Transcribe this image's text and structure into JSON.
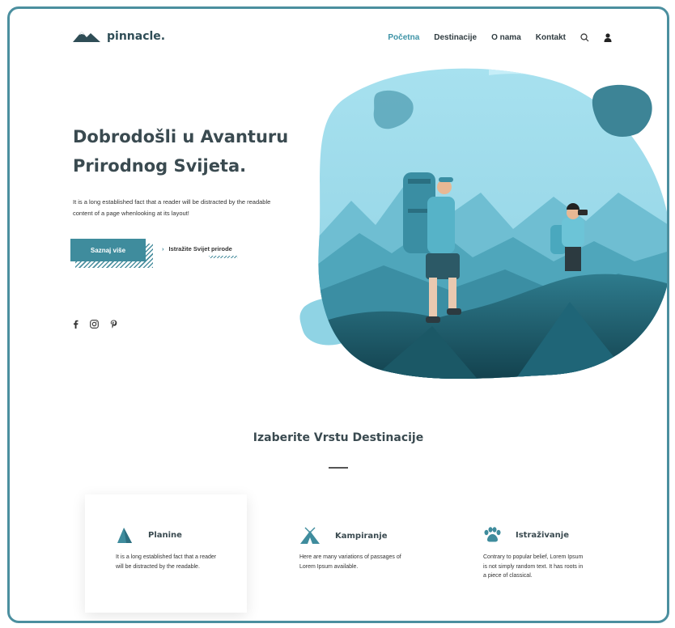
{
  "brand": {
    "name": "pinnacle."
  },
  "nav": {
    "items": [
      {
        "label": "Početna",
        "active": true
      },
      {
        "label": "Destinacije",
        "active": false
      },
      {
        "label": "O nama",
        "active": false
      },
      {
        "label": "Kontakt",
        "active": false
      }
    ],
    "icons": [
      "search-icon",
      "user-icon"
    ]
  },
  "hero": {
    "title": "Dobrodošli u Avanturu Prirodnog Svijeta.",
    "text": "It is a long established fact that a reader will be distracted by the readable content of a page whenlooking at its layout!",
    "primary_button": "Saznaj više",
    "secondary_link": "Istražite Svijet prirode",
    "social_icons": [
      "facebook-icon",
      "instagram-icon",
      "pinterest-icon"
    ]
  },
  "section": {
    "title": "Izaberite Vrstu Destinacije",
    "cards": [
      {
        "icon": "mountain-icon",
        "title": "Planine",
        "text": "It is a long established fact that a reader will be distracted by the readable."
      },
      {
        "icon": "tent-icon",
        "title": "Kampiranje",
        "text": "Here are many variations of passages of Lorem Ipsum available."
      },
      {
        "icon": "paw-icon",
        "title": "Istraživanje",
        "text": "Contrary to popular belief, Lorem Ipsum is not simply random text. It has roots in a piece of classical."
      }
    ]
  },
  "colors": {
    "accent": "#3f8c9d",
    "heading": "#3a4a50",
    "frame": "#4b8f9f",
    "light_blob": "#bfeaf5"
  }
}
